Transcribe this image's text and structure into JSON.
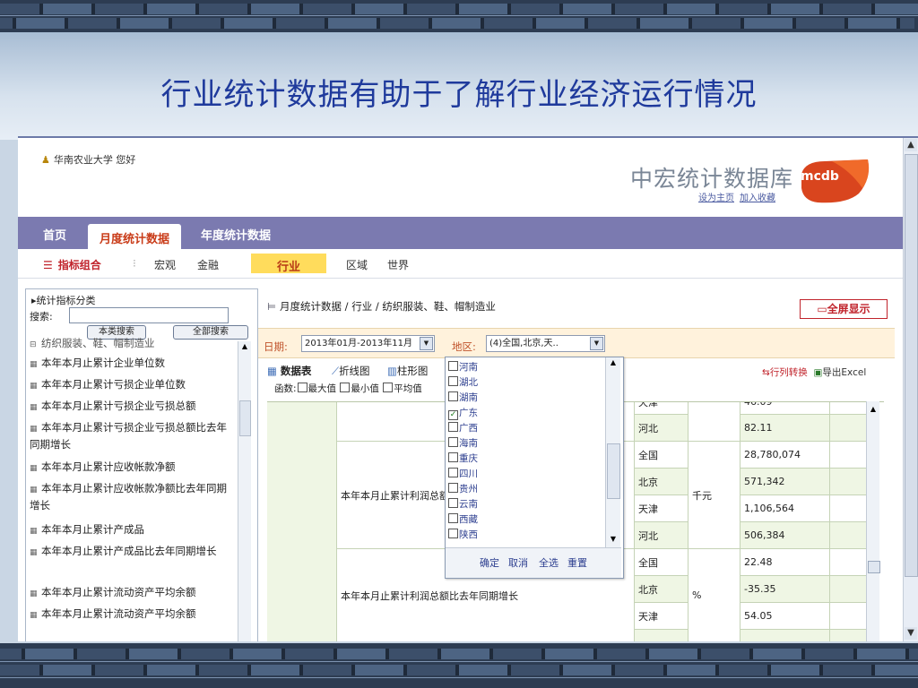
{
  "slide": {
    "title": "行业统计数据有助于了解行业经济运行情况"
  },
  "header": {
    "greeting": "华南农业大学 您好",
    "brand_title": "中宏统计数据库",
    "logo_text": "mcdb",
    "links": [
      "设为主页",
      "加入收藏"
    ]
  },
  "nav": {
    "items": [
      "首页",
      "月度统计数据",
      "年度统计数据"
    ],
    "active": "月度统计数据"
  },
  "subnav": {
    "combo": "指标组合",
    "items": [
      "宏观",
      "金融",
      "行业",
      "区域",
      "世界"
    ],
    "selected": "行业"
  },
  "left_panel": {
    "header": "统计指标分类",
    "search_label": "搜索:",
    "search_value": "",
    "buttons": [
      "本类搜索",
      "全部搜索"
    ],
    "group": "纺织服装、鞋、帽制造业",
    "items": [
      "本年本月止累计企业单位数",
      "本年本月止累计亏损企业单位数",
      "本年本月止累计亏损企业亏损总额",
      "本年本月止累计亏损企业亏损总额比去年同期增长",
      "本年本月止累计应收帐款净额",
      "本年本月止累计应收帐款净额比去年同期增长",
      "本年本月止累计产成品",
      "本年本月止累计产成品比去年同期增长",
      "本年本月止累计流动资产平均余额",
      "本年本月止累计流动资产平均余额"
    ]
  },
  "main": {
    "breadcrumb": "月度统计数据 / 行业 / 纺织服装、鞋、帽制造业",
    "fullscreen": "全屏显示",
    "date_label": "日期:",
    "date_value": "2013年01月-2013年11月",
    "region_label": "地区:",
    "region_value": "(4)全国,北京,天..",
    "tabs": [
      "数据表",
      "折线图",
      "柱形图"
    ],
    "functions_label": "函数:",
    "functions": [
      "最大值",
      "最小值",
      "平均值"
    ],
    "tools": [
      "行列转换",
      "导出Excel"
    ],
    "table": {
      "row_top": {
        "region": "天津",
        "value": "46.09"
      },
      "groups": [
        {
          "indicator": "",
          "unit": "",
          "rows": [
            {
              "region": "河北",
              "value": "82.11"
            }
          ]
        },
        {
          "indicator": "本年本月止累计利润总额",
          "unit": "千元",
          "rows": [
            {
              "region": "全国",
              "value": "28,780,074"
            },
            {
              "region": "北京",
              "value": "571,342"
            },
            {
              "region": "天津",
              "value": "1,106,564"
            },
            {
              "region": "河北",
              "value": "506,384"
            }
          ]
        },
        {
          "indicator": "本年本月止累计利润总额比去年同期增长",
          "unit": "%",
          "rows": [
            {
              "region": "全国",
              "value": "22.48"
            },
            {
              "region": "北京",
              "value": "-35.35"
            },
            {
              "region": "天津",
              "value": "54.05"
            }
          ]
        }
      ]
    },
    "region_popup": {
      "options": [
        {
          "label": "河南",
          "checked": false
        },
        {
          "label": "湖北",
          "checked": false
        },
        {
          "label": "湖南",
          "checked": false
        },
        {
          "label": "广东",
          "checked": true
        },
        {
          "label": "广西",
          "checked": false
        },
        {
          "label": "海南",
          "checked": false
        },
        {
          "label": "重庆",
          "checked": false
        },
        {
          "label": "四川",
          "checked": false
        },
        {
          "label": "贵州",
          "checked": false
        },
        {
          "label": "云南",
          "checked": false
        },
        {
          "label": "西藏",
          "checked": false
        },
        {
          "label": "陕西",
          "checked": false
        }
      ],
      "actions": [
        "确定",
        "取消",
        "全选",
        "重置"
      ]
    }
  }
}
